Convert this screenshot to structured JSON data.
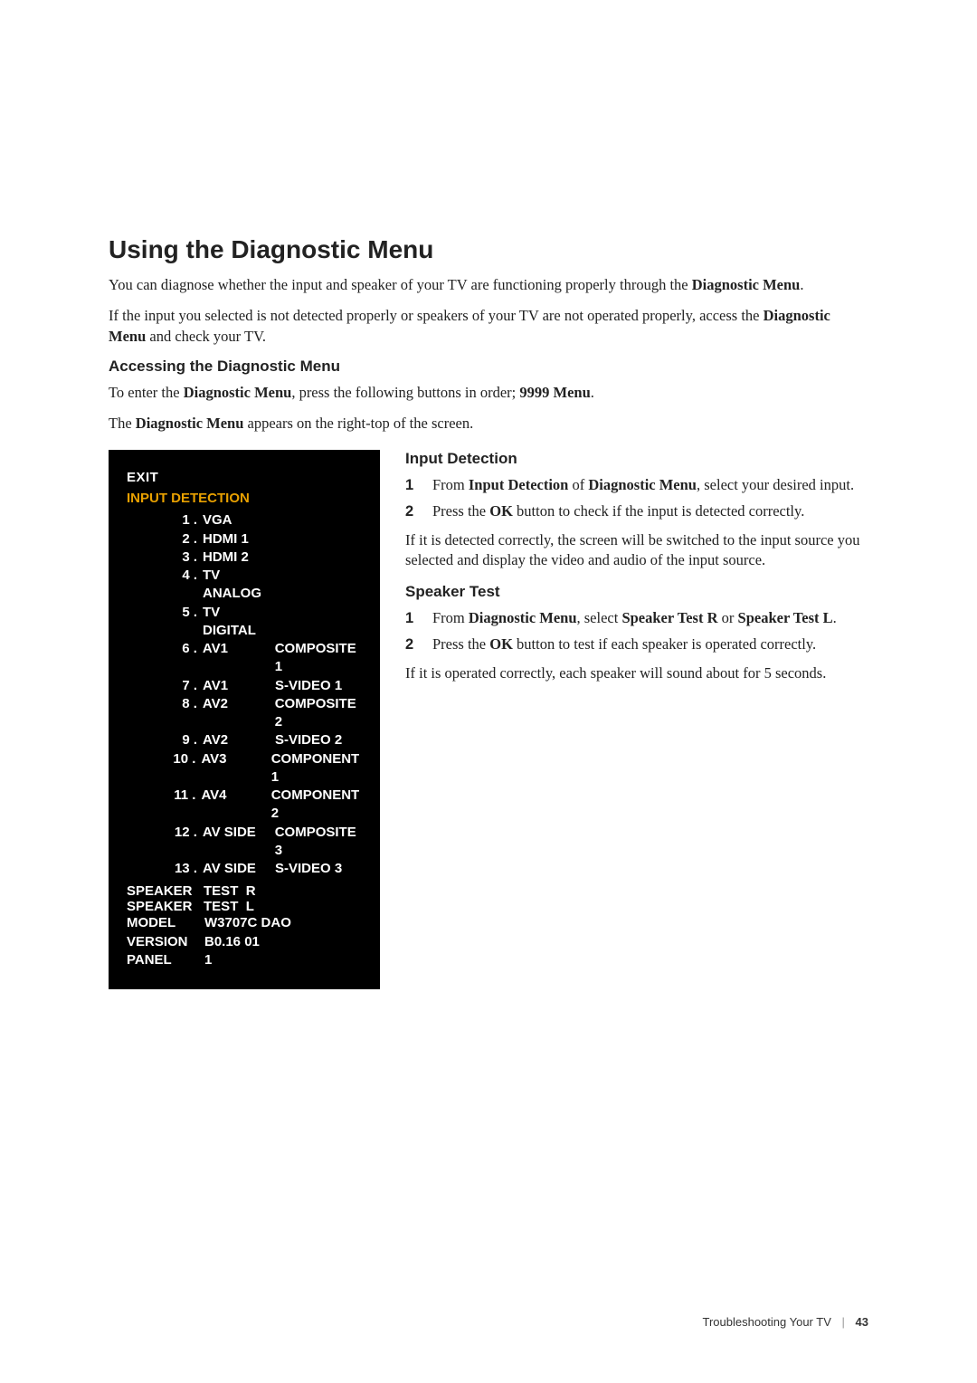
{
  "page": {
    "heading": "Using the Diagnostic Menu",
    "intro1_pre": "You can diagnose whether the input and speaker of your TV are functioning properly through the ",
    "intro1_bold": "Diagnostic Menu",
    "intro1_post": ".",
    "intro2_pre": "If the input you selected is not detected properly or speakers of your TV are not operated properly, access the ",
    "intro2_bold": "Diagnostic Menu",
    "intro2_post": " and check your TV.",
    "access_heading": "Accessing the Diagnostic Menu",
    "access1_pre": "To enter the ",
    "access1_bold1": "Diagnostic Menu",
    "access1_mid": ", press the following buttons in order; ",
    "access1_bold2": "9999 Menu",
    "access1_post": ".",
    "access2_pre": "The ",
    "access2_bold": "Diagnostic Menu",
    "access2_post": " appears on the right-top of the screen."
  },
  "menu": {
    "exit": "EXIT",
    "input_detection": "INPUT DETECTION",
    "inputs": [
      {
        "num": "1 .",
        "label": "VGA",
        "extra": ""
      },
      {
        "num": "2 .",
        "label": "HDMI 1",
        "extra": ""
      },
      {
        "num": "3 .",
        "label": "HDMI 2",
        "extra": ""
      },
      {
        "num": "4 .",
        "label": "TV ANALOG",
        "extra": ""
      },
      {
        "num": "5 .",
        "label": "TV DIGITAL",
        "extra": ""
      },
      {
        "num": "6 .",
        "label": "AV1",
        "extra": "COMPOSITE 1"
      },
      {
        "num": "7 .",
        "label": "AV1",
        "extra": "S-VIDEO 1"
      },
      {
        "num": "8 .",
        "label": "AV2",
        "extra": "COMPOSITE 2"
      },
      {
        "num": "9 .",
        "label": "AV2",
        "extra": "S-VIDEO 2"
      },
      {
        "num": "10 .",
        "label": "AV3",
        "extra": "COMPONENT 1"
      },
      {
        "num": "11 .",
        "label": "AV4",
        "extra": "COMPONENT 2"
      },
      {
        "num": "12 .",
        "label": "AV SIDE",
        "extra": "COMPOSITE 3"
      },
      {
        "num": "13 .",
        "label": "AV SIDE",
        "extra": "S-VIDEO 3"
      }
    ],
    "speaker_r": "SPEAKER   TEST  R",
    "speaker_l": "SPEAKER   TEST  L",
    "model_key": "MODEL",
    "model_val": "W3707C DAO",
    "version_key": "VERSION",
    "version_val": "B0.16 01",
    "panel_key": "PANEL",
    "panel_val": "1"
  },
  "right": {
    "input_detection_heading": "Input Detection",
    "idet": [
      {
        "num": "1",
        "pre": "From ",
        "b1": "Input Detection",
        "mid1": " of ",
        "b2": "Diagnostic Menu",
        "post": ", select your desired input."
      },
      {
        "num": "2",
        "pre": "Press the ",
        "b1": "OK",
        "mid1": " button to check if the input is detected correctly.",
        "b2": "",
        "post": ""
      }
    ],
    "idet_para": "If it is detected correctly, the screen will be switched to the input source you selected and display the video and audio of the input source.",
    "speaker_heading": "Speaker Test",
    "sp": [
      {
        "num": "1",
        "pre": "From ",
        "b1": "Diagnostic Menu",
        "mid1": ", select ",
        "b2": "Speaker Test R",
        "mid2": " or ",
        "b3": "Speaker Test L",
        "post": "."
      },
      {
        "num": "2",
        "pre": "Press the ",
        "b1": "OK",
        "mid1": " button to test if each speaker is operated correctly.",
        "b2": "",
        "mid2": "",
        "b3": "",
        "post": ""
      }
    ],
    "sp_para": "If it is operated correctly, each speaker will sound about for 5 seconds."
  },
  "footer": {
    "section": "Troubleshooting Your TV",
    "page": "43"
  }
}
